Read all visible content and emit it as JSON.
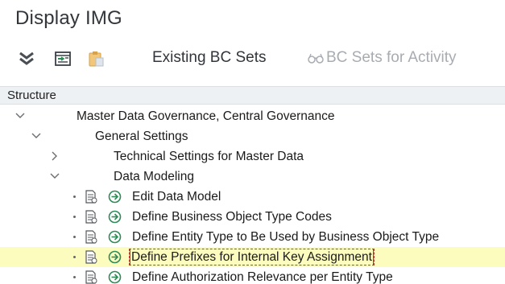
{
  "window": {
    "title": "Display IMG"
  },
  "toolbar": {
    "expand_icon": "double-chevron-down-icon",
    "find_icon": "find-in-tree-icon",
    "bcset_icon": "clipboard-icon",
    "existing_bc_sets": "Existing BC Sets",
    "bc_sets_for_activity": "BC Sets for Activity",
    "glasses_icon": "glasses-icon"
  },
  "structure": {
    "header": "Structure",
    "nodes": [
      {
        "label": "Master Data Governance, Central Governance",
        "state": "expanded"
      },
      {
        "label": "General Settings",
        "state": "expanded"
      },
      {
        "label": "Technical Settings for Master Data",
        "state": "collapsed"
      },
      {
        "label": "Data Modeling",
        "state": "expanded"
      },
      {
        "label": "Edit Data Model",
        "type": "activity"
      },
      {
        "label": "Define Business Object Type Codes",
        "type": "activity"
      },
      {
        "label": "Define Entity Type to Be Used by Business Object Type",
        "type": "activity"
      },
      {
        "label": "Define Prefixes for Internal Key Assignment",
        "type": "activity",
        "selected": true
      },
      {
        "label": "Define Authorization Relevance per Entity Type",
        "type": "activity"
      }
    ]
  },
  "colors": {
    "selected_row": "#fcfcbe",
    "exec_icon": "#2e8b57",
    "header_bg": "#eef1f4"
  }
}
